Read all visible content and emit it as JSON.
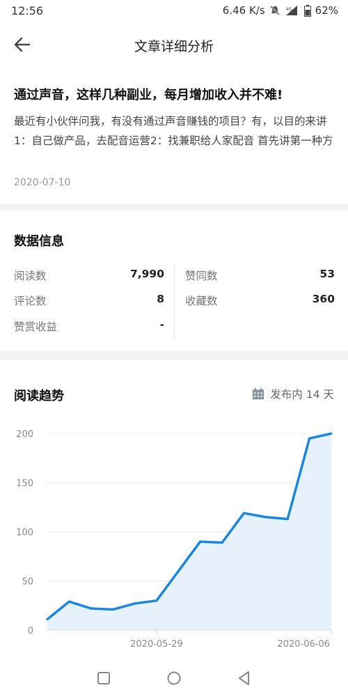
{
  "status_bar": {
    "time": "12:56",
    "speed": "6.46 K/s",
    "network": "4G",
    "battery": "62%"
  },
  "header": {
    "title": "文章详细分析"
  },
  "article": {
    "title": "通过声音，这样几种副业，每月增加收入并不难!",
    "excerpt": "最近有小伙伴问我，有没有通过声音赚钱的项目？有，以目的来讲1：自己做产品，去配音运营2：找兼职给人家配音 首先讲第一种方法，直接搜索 喜马拉雅有声制作平台 [图片] 进去…",
    "date": "2020-07-10"
  },
  "data_info": {
    "title": "数据信息",
    "stats": [
      {
        "label": "阅读数",
        "value": "7,990"
      },
      {
        "label": "评论数",
        "value": "8"
      },
      {
        "label": "赞赏收益",
        "value": "-"
      },
      {
        "label": "赞同数",
        "value": "53"
      },
      {
        "label": "收藏数",
        "value": "360"
      }
    ]
  },
  "trend": {
    "title": "阅读趋势",
    "range_label": "发布内 14 天",
    "calendar_icon": "calendar-icon"
  },
  "chart_data": {
    "type": "area",
    "x": [
      "2020-05-24",
      "2020-05-25",
      "2020-05-26",
      "2020-05-27",
      "2020-05-28",
      "2020-05-29",
      "2020-05-30",
      "2020-05-31",
      "2020-06-01",
      "2020-06-02",
      "2020-06-03",
      "2020-06-04",
      "2020-06-05",
      "2020-06-06"
    ],
    "series": [
      {
        "values": [
          11,
          29,
          22,
          21,
          27,
          30,
          60,
          90,
          89,
          119,
          115,
          113,
          195,
          200
        ]
      }
    ],
    "yticks": [
      0,
      50,
      100,
      150,
      200
    ],
    "xtick_labels": [
      "2020-05-29",
      "2020-06-06"
    ],
    "ylim": [
      0,
      200
    ],
    "grid": "horizontal",
    "line_color": "#1a86e0",
    "fill_color": "#e6f1fc"
  },
  "nav_bar": {
    "icons": [
      "square-icon",
      "circle-icon",
      "triangle-back-icon"
    ]
  }
}
